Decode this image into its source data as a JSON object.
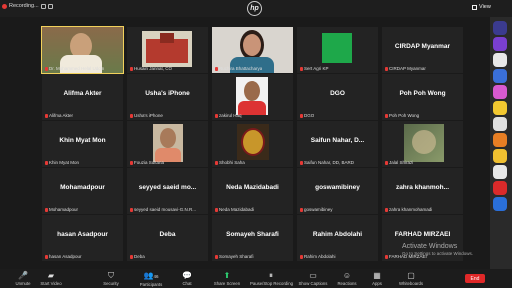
{
  "topbar": {
    "recording": "Recording...",
    "view": "View"
  },
  "tiles": [
    {
      "id": "t1",
      "label": "Dr. Mohammed Helal Uddin",
      "big": "",
      "type": "photo-man"
    },
    {
      "id": "t2",
      "label": "Husain Jannat, CO",
      "big": "",
      "type": "photo-building"
    },
    {
      "id": "t3",
      "label": "Ruchira Bhattacharya",
      "big": "",
      "type": "photo-woman"
    },
    {
      "id": "t4",
      "label": "Sert Agri KP",
      "big": "",
      "type": "green"
    },
    {
      "id": "t5",
      "label": "CIRDAP Myanmar",
      "big": "CIRDAP Myanmar",
      "type": "text"
    },
    {
      "id": "t6",
      "label": "Alifma Akter",
      "big": "Alifma Akter",
      "type": "text"
    },
    {
      "id": "t7",
      "label": "Usha's iPhone",
      "big": "Usha's iPhone",
      "type": "text"
    },
    {
      "id": "t8",
      "label": "zakirul Haq",
      "big": "",
      "type": "photo-man2"
    },
    {
      "id": "t9",
      "label": "DGO",
      "big": "DGO",
      "type": "text"
    },
    {
      "id": "t10",
      "label": "Poh Poh Wong",
      "big": "Poh Poh Wong",
      "type": "text"
    },
    {
      "id": "t11",
      "label": "Khin Myat Mon",
      "big": "Khin Myat Mon",
      "type": "text"
    },
    {
      "id": "t12",
      "label": "Fouzia Sultana",
      "big": "",
      "type": "photo-woman2"
    },
    {
      "id": "t13",
      "label": "Shobhi Saha",
      "big": "",
      "type": "photo-emblem"
    },
    {
      "id": "t14",
      "label": "Saifun Nahar, DD, BARD",
      "big": "Saifun Nahar, D...",
      "type": "text"
    },
    {
      "id": "t15",
      "label": "Jalal Shirazi",
      "big": "",
      "type": "photo-art"
    },
    {
      "id": "t16",
      "label": "Mohamadpour",
      "big": "Mohamadpour",
      "type": "text"
    },
    {
      "id": "t17",
      "label": "seyyed saeid mousavi-G.N.R...",
      "big": "seyyed saeid mo...",
      "type": "text"
    },
    {
      "id": "t18",
      "label": "Neda Mazidabadi",
      "big": "Neda Mazidabadi",
      "type": "text"
    },
    {
      "id": "t19",
      "label": "goswamibiney",
      "big": "goswamibiney",
      "type": "text"
    },
    {
      "id": "t20",
      "label": "zahra khanmohamadi",
      "big": "zahra khanmoh...",
      "type": "text"
    },
    {
      "id": "t21",
      "label": "hasan Asadpour",
      "big": "hasan Asadpour",
      "type": "text"
    },
    {
      "id": "t22",
      "label": "Deba",
      "big": "Deba",
      "type": "text"
    },
    {
      "id": "t23",
      "label": "Somayeh Sharafi",
      "big": "Somayeh Sharafi",
      "type": "text"
    },
    {
      "id": "t24",
      "label": "Rahim Abdolahi",
      "big": "Rahim Abdolahi",
      "type": "text"
    },
    {
      "id": "t25",
      "label": "FARHAD MIRZAEI",
      "big": "FARHAD MIRZAEI",
      "type": "text"
    }
  ],
  "toolbar": {
    "unmute": "Unmute",
    "start_video": "Start Video",
    "security": "Security",
    "participants": "Participants",
    "participants_count": "46",
    "chat": "Chat",
    "share": "Share Screen",
    "pause_rec": "Pause/Stop Recording",
    "captions": "Show Captions",
    "reactions": "Reactions",
    "apps": "Apps",
    "whiteboards": "Whiteboards",
    "end": "End"
  },
  "activate": {
    "title": "Activate Windows",
    "subtitle": "Go to Settings to activate Windows."
  },
  "colors": {
    "accent_green": "#2ecc71",
    "end_red": "#e02828",
    "active_outline": "#f2d15b"
  },
  "rightbar_icons": [
    "Alive",
    "W",
    "bell",
    "O",
    "ember",
    "K",
    "c",
    "O",
    "smile",
    "mail",
    "red",
    "blue"
  ]
}
